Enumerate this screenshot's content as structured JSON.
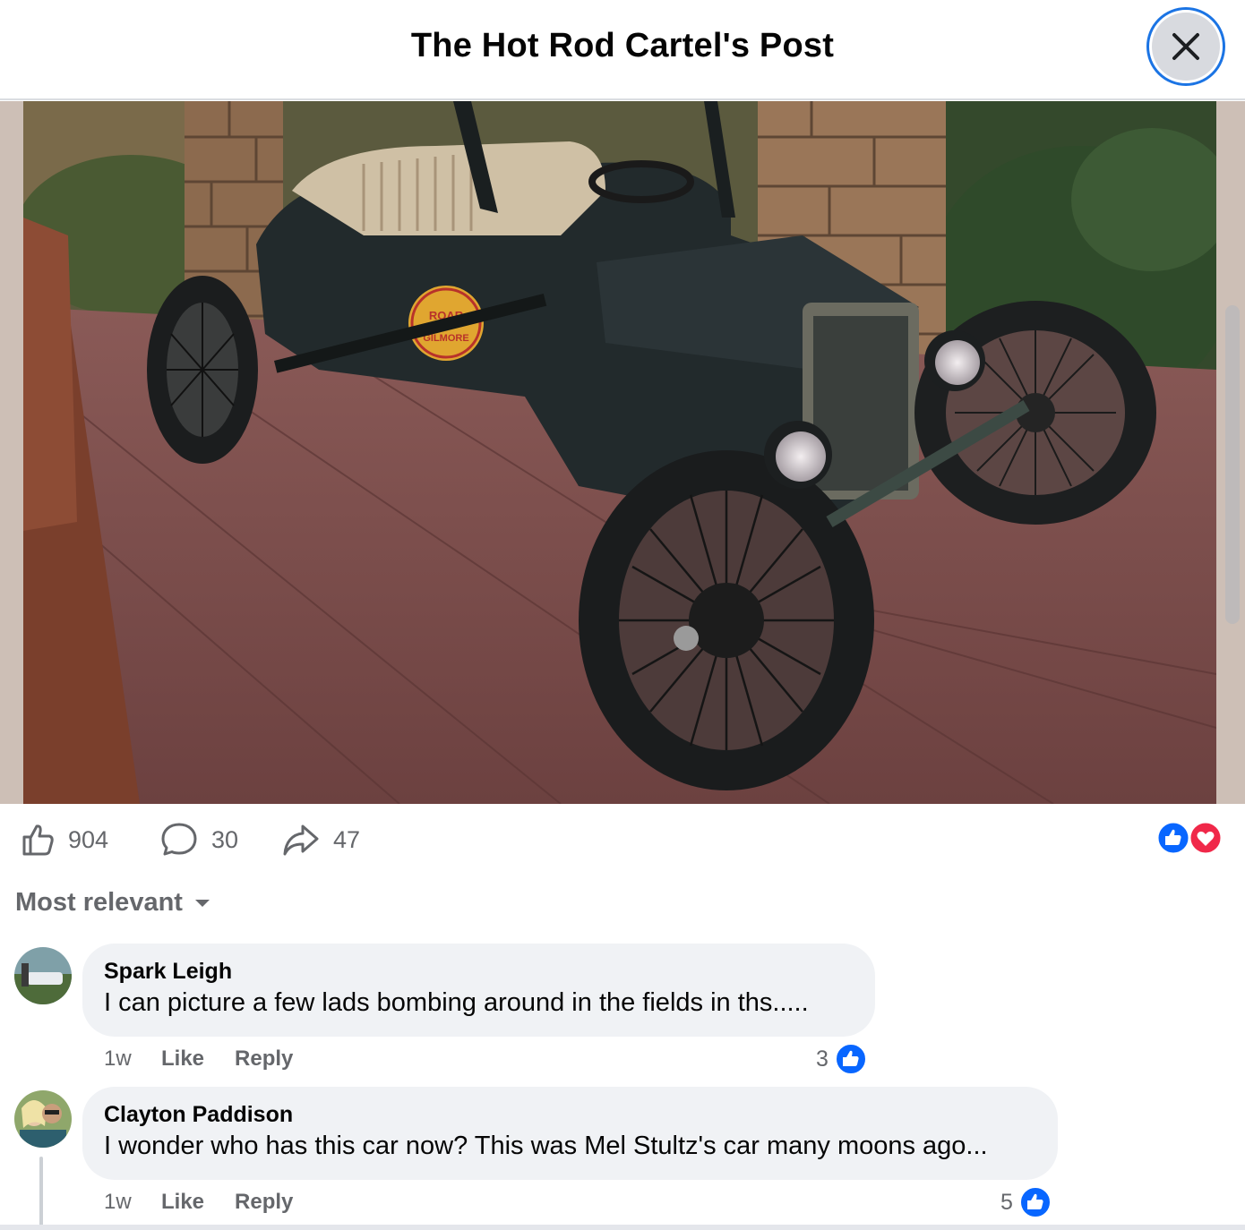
{
  "header": {
    "title": "The Hot Rod Cartel's Post"
  },
  "photo": {
    "sign": {
      "line1": "ROAR",
      "line2": "GILMORE"
    }
  },
  "stats": {
    "likes": "904",
    "comments": "30",
    "shares": "47"
  },
  "sort": {
    "label": "Most relevant"
  },
  "comments": [
    {
      "author": "Spark Leigh",
      "text": "I can picture a few lads bombing around in the fields in ths.....",
      "time": "1w",
      "like_label": "Like",
      "reply_label": "Reply",
      "reactions": "3"
    },
    {
      "author": "Clayton Paddison",
      "text": "I wonder who has this car now? This was Mel Stultz's car many moons ago...",
      "time": "1w",
      "like_label": "Like",
      "reply_label": "Reply",
      "reactions": "5"
    }
  ],
  "colors": {
    "accent": "#1b74e4",
    "like_blue": "#0866ff",
    "love_red": "#f02849",
    "secondary_text": "#65676b",
    "bubble_bg": "#f0f2f5"
  }
}
